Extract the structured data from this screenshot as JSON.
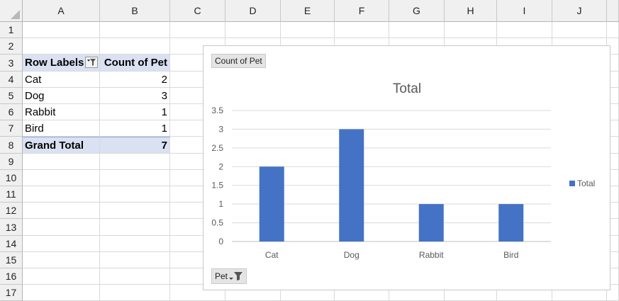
{
  "sheet": {
    "columns": [
      "A",
      "B",
      "C",
      "D",
      "E",
      "F",
      "G",
      "H",
      "I",
      "J"
    ],
    "rows": [
      "1",
      "2",
      "3",
      "4",
      "5",
      "6",
      "7",
      "8",
      "9",
      "10",
      "11",
      "12",
      "13",
      "14",
      "15",
      "16",
      "17"
    ]
  },
  "pivot": {
    "header_label": "Row Labels",
    "header_value": "Count of Pet",
    "rows": [
      {
        "label": "Cat",
        "value": "2"
      },
      {
        "label": "Dog",
        "value": "3"
      },
      {
        "label": "Rabbit",
        "value": "1"
      },
      {
        "label": "Bird",
        "value": "1"
      }
    ],
    "grand_total_label": "Grand Total",
    "grand_total_value": "7"
  },
  "chart_ui": {
    "value_field_button": "Count of Pet",
    "axis_field_button": "Pet"
  },
  "chart_data": {
    "type": "bar",
    "title": "Total",
    "categories": [
      "Cat",
      "Dog",
      "Rabbit",
      "Bird"
    ],
    "series": [
      {
        "name": "Total",
        "values": [
          2,
          3,
          1,
          1
        ]
      }
    ],
    "ylim": [
      0,
      3.5
    ],
    "yticks": [
      "0",
      "0.5",
      "1",
      "1.5",
      "2",
      "2.5",
      "3",
      "3.5"
    ],
    "grid": true,
    "legend": "right",
    "colors": {
      "bar": "#4472c4",
      "grid": "#d9d9d9",
      "axis": "#bfbfbf",
      "title": "#595959",
      "tick": "#595959"
    }
  }
}
